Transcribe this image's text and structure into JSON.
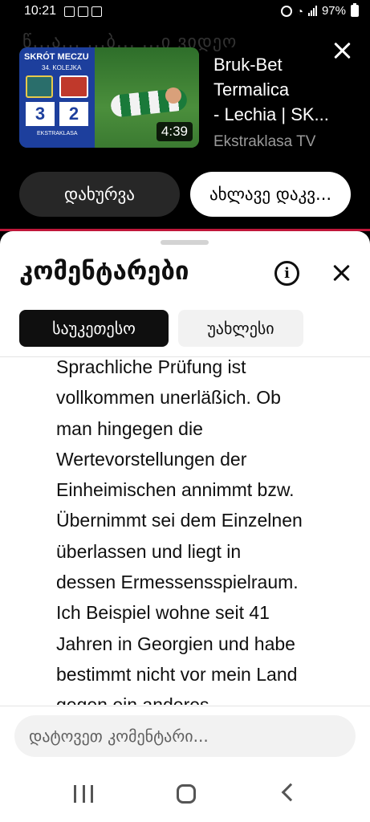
{
  "status_bar": {
    "time": "10:21",
    "battery": "97%"
  },
  "player": {
    "background_title": "წ...ა... ...ბ... ...ი ვიდეო",
    "thumbnail": {
      "header": "SKRÓT MECZU",
      "round": "34. KOLEJKA",
      "score_home": "3",
      "score_away": "2",
      "league_logo": "EKSTRAKLASA"
    },
    "duration": "4:39",
    "title_lines": [
      "Bruk-Bet",
      "Termalica",
      "- Lechia | SK..."
    ],
    "channel": "Ekstraklasa TV",
    "dismiss_label": "დახურვა",
    "watch_label": "ახლავე დაკვ..."
  },
  "comments": {
    "title": "კომენტარები",
    "sort_chips": [
      {
        "label": "საუკეთესო",
        "selected": true
      },
      {
        "label": "უახლესი",
        "selected": false
      }
    ],
    "comment_lines": [
      "Sprachliche Prüfung ist",
      "vollkommen unerläßich. Ob",
      "man hingegen die",
      "Wertevorstellungen der",
      "Einheimischen annimmt bzw.",
      "Übernimmt sei dem Einzelnen",
      "überlassen und liegt in",
      "dessen Ermessensspielraum.",
      "Ich Beispiel wohne seit 41",
      "Jahren in Georgien und habe",
      "bestimmt nicht vor mein Land",
      "gegen ein anderes"
    ],
    "input_placeholder": "დატოვეთ კომენტარი..."
  },
  "colors": {
    "accent": "#c0173a",
    "chip_selected_bg": "#0f0f0f",
    "chip_bg": "#f2f2f2"
  },
  "icons": {
    "close": "close-icon",
    "info": "info-icon",
    "nav_recent": "recent-apps-icon",
    "nav_home": "home-icon",
    "nav_back": "back-icon"
  }
}
